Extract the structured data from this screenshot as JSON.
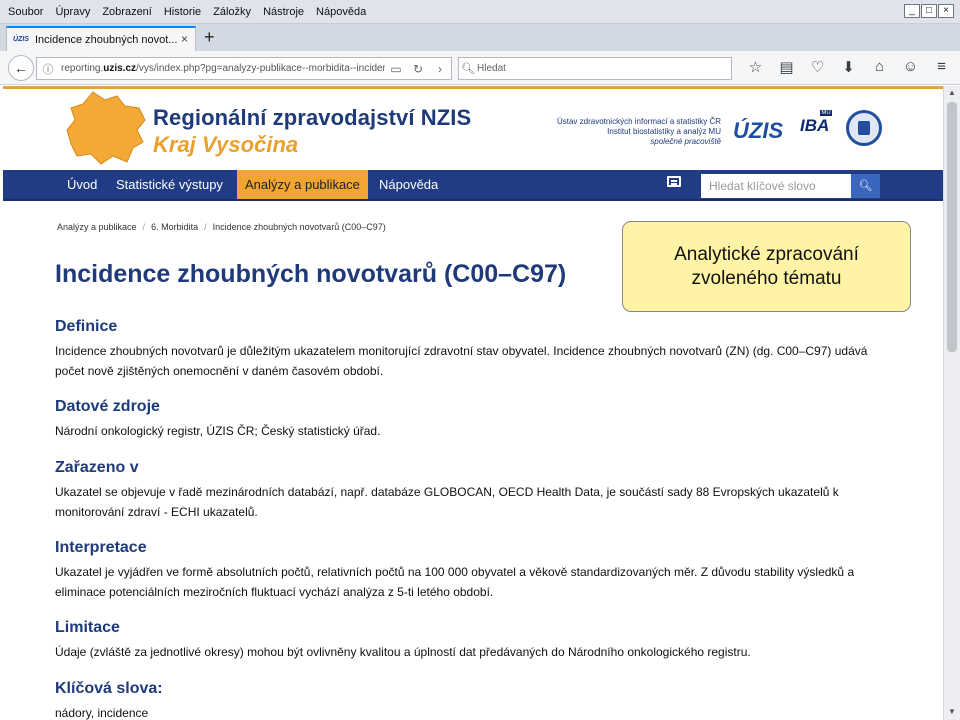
{
  "browser": {
    "menu": [
      "Soubor",
      "Úpravy",
      "Zobrazení",
      "Historie",
      "Záložky",
      "Nástroje",
      "Nápověda"
    ],
    "window_controls": [
      "_",
      "□",
      "×"
    ],
    "tab": {
      "favicon_text": "ÚZIS",
      "title": "Incidence zhoubných novot...",
      "close": "×"
    },
    "new_tab": "+",
    "url": {
      "prefix": "reporting.",
      "domain": "uzis.cz",
      "rest": "/vys/index.php?pg=analyzy-publikace--morbidita--incidence"
    },
    "search_placeholder": "Hledat"
  },
  "site": {
    "title": "Regionální zpravodajství NZIS",
    "subtitle": "Kraj Vysočina",
    "institute_lines": [
      "Ústav zdravotnických informací a statistiky ČR",
      "Institut biostatistiky a analýz MU"
    ],
    "institute_note": "společné pracoviště",
    "logo_uzis": "ÚZIS",
    "logo_mu": "MU",
    "logo_iba": "IBA"
  },
  "nav": {
    "items": [
      "Úvod",
      "Statistické výstupy",
      "Analýzy a publikace",
      "Nápověda"
    ],
    "active": "Analýzy a publikace",
    "search_placeholder": "Hledat klíčové slovo"
  },
  "breadcrumb": [
    "Analýzy a publikace",
    "6. Morbidita",
    "Incidence zhoubných novotvarů (C00–C97)"
  ],
  "page_title": "Incidence zhoubných novotvarů (C00–C97)",
  "callout": [
    "Analytické zpracování",
    "zvoleného tématu"
  ],
  "sections": [
    {
      "heading": "Definice",
      "text": "Incidence zhoubných novotvarů je důležitým ukazatelem monitorující zdravotní stav obyvatel. Incidence zhoubných novotvarů (ZN) (dg. C00–C97) udává počet nově zjištěných onemocnění v daném časovém období."
    },
    {
      "heading": "Datové zdroje",
      "text": "Národní onkologický registr, ÚZIS ČR; Český statistický úřad."
    },
    {
      "heading": "Zařazeno v",
      "text": "Ukazatel se objevuje v řadě mezinárodních databází, např. databáze GLOBOCAN, OECD Health Data, je součástí sady 88 Evropských ukazatelů k monitorování zdraví - ECHI ukazatelů."
    },
    {
      "heading": "Interpretace",
      "text": "Ukazatel je vyjádřen ve formě absolutních počtů, relativních počtů na 100 000 obyvatel a věkově standardizovaných měr. Z důvodu stability výsledků a eliminace potenciálních meziročních fluktuací vychází analýza z 5-ti letého období."
    },
    {
      "heading": "Limitace",
      "text": "Údaje (zvláště za jednotlivé okresy) mohou být ovlivněny kvalitou a úplností dat předávaných do Národního onkologického registru."
    },
    {
      "heading": "Klíčová slova:",
      "text": "nádory, incidence"
    }
  ]
}
